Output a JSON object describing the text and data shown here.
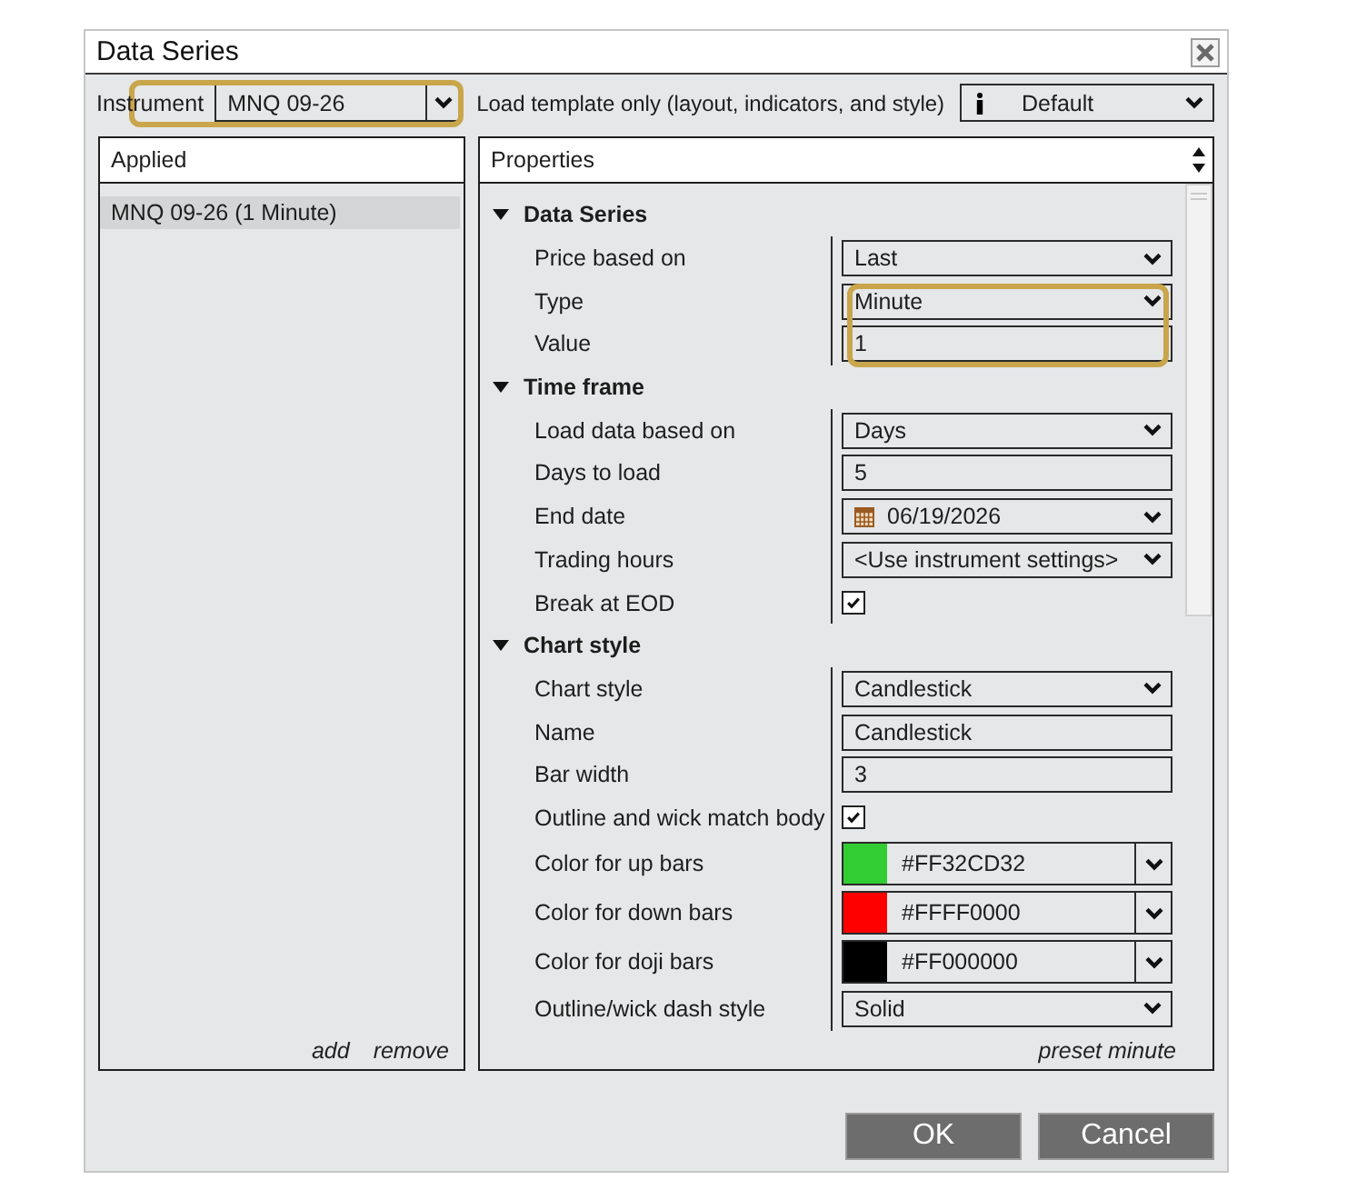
{
  "window": {
    "title": "Data Series"
  },
  "toolbar": {
    "instrument_label": "Instrument",
    "instrument": {
      "value": "MNQ 09-26",
      "highlighted": true
    },
    "template_label": "Load template only (layout, indicators, and style)",
    "template": {
      "value": "Default"
    }
  },
  "applied": {
    "title": "Applied",
    "items": [
      {
        "label": "MNQ 09-26 (1 Minute)",
        "selected": true
      }
    ],
    "links": [
      "add",
      "remove"
    ]
  },
  "properties": {
    "title": "Properties",
    "categories": [
      {
        "title": "Data Series",
        "expanded": true,
        "rows": [
          {
            "label": "Price based on",
            "kind": "dropdown",
            "value": "Last",
            "highlighted": false
          },
          {
            "label": "Type",
            "kind": "dropdown",
            "value": "Minute",
            "highlighted": true
          },
          {
            "label": "Value",
            "kind": "text",
            "value": "1",
            "highlighted": true
          }
        ]
      },
      {
        "title": "Time frame",
        "expanded": true,
        "rows": [
          {
            "label": "Load data based on",
            "kind": "dropdown",
            "value": "Days",
            "highlighted": false
          },
          {
            "label": "Days to load",
            "kind": "text",
            "value": "5",
            "highlighted": false
          },
          {
            "label": "End date",
            "kind": "date",
            "value": "06/19/2026",
            "highlighted": false
          },
          {
            "label": "Trading hours",
            "kind": "dropdown",
            "value": "<Use instrument settings>",
            "highlighted": false
          },
          {
            "label": "Break at EOD",
            "kind": "checkbox",
            "checked": true,
            "highlighted": false
          }
        ]
      },
      {
        "title": "Chart style",
        "expanded": true,
        "rows": [
          {
            "label": "Chart style",
            "kind": "dropdown",
            "value": "Candlestick",
            "highlighted": false
          },
          {
            "label": "Name",
            "kind": "text",
            "value": "Candlestick",
            "highlighted": false
          },
          {
            "label": "Bar width",
            "kind": "text",
            "value": "3",
            "highlighted": false
          },
          {
            "label": "Outline and wick match body",
            "kind": "checkbox",
            "checked": true,
            "highlighted": false
          },
          {
            "label": "Color for up bars",
            "kind": "color",
            "value": "#FF32CD32",
            "color": "#32cd32",
            "highlighted": false
          },
          {
            "label": "Color for down bars",
            "kind": "color",
            "value": "#FFFF0000",
            "color": "#ff0000",
            "highlighted": false
          },
          {
            "label": "Color for doji bars",
            "kind": "color",
            "value": "#FF000000",
            "color": "#000000",
            "highlighted": false
          },
          {
            "label": "Outline/wick dash style",
            "kind": "dropdown",
            "value": "Solid",
            "highlighted": false
          }
        ]
      }
    ],
    "link": "preset minute"
  },
  "buttons": [
    "OK",
    "Cancel"
  ]
}
